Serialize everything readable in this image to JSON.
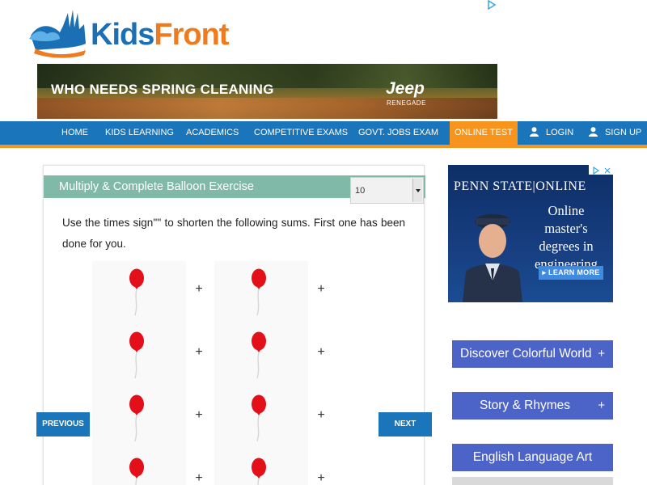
{
  "logo": {
    "kids": "Kids",
    "front": "Front"
  },
  "top_ad": {
    "headline": "WHO NEEDS SPRING CLEANING",
    "brand": "Jeep",
    "model": "RENEGADE"
  },
  "nav": {
    "items": [
      "HOME",
      "KIDS LEARNING",
      "ACADEMICS",
      "COMPETITIVE EXAMS",
      "GOVT. JOBS EXAM",
      "ONLINE TEST"
    ],
    "login": "LOGIN",
    "signup": "SIGN UP",
    "active_item": "ONLINE TEST"
  },
  "exercise": {
    "title": "Multiply & Complete Balloon Exercise",
    "select_value": "10",
    "instructions": "Use the times sign'\"' to shorten the following sums. First one has been done for you.",
    "plus_sign": "+",
    "prev_label": "PREVIOUS",
    "next_label": "NEXT"
  },
  "side_ad": {
    "title": "PENN STATE|ONLINE",
    "line": "Online master's degrees in engineering",
    "button": "▸ LEARN MORE"
  },
  "sidebar": {
    "buttons": [
      {
        "label": "Discover Colorful World",
        "icon": "+"
      },
      {
        "label": "Story & Rhymes",
        "icon": "+"
      },
      {
        "label": "English Language Art"
      }
    ]
  },
  "colors": {
    "nav_blue": "#1b75bb",
    "accent_orange": "#f7941d",
    "exercise_header": "#80b9a7",
    "sidebar_button": "#4c64c7",
    "balloon_red": "#e3101a"
  }
}
